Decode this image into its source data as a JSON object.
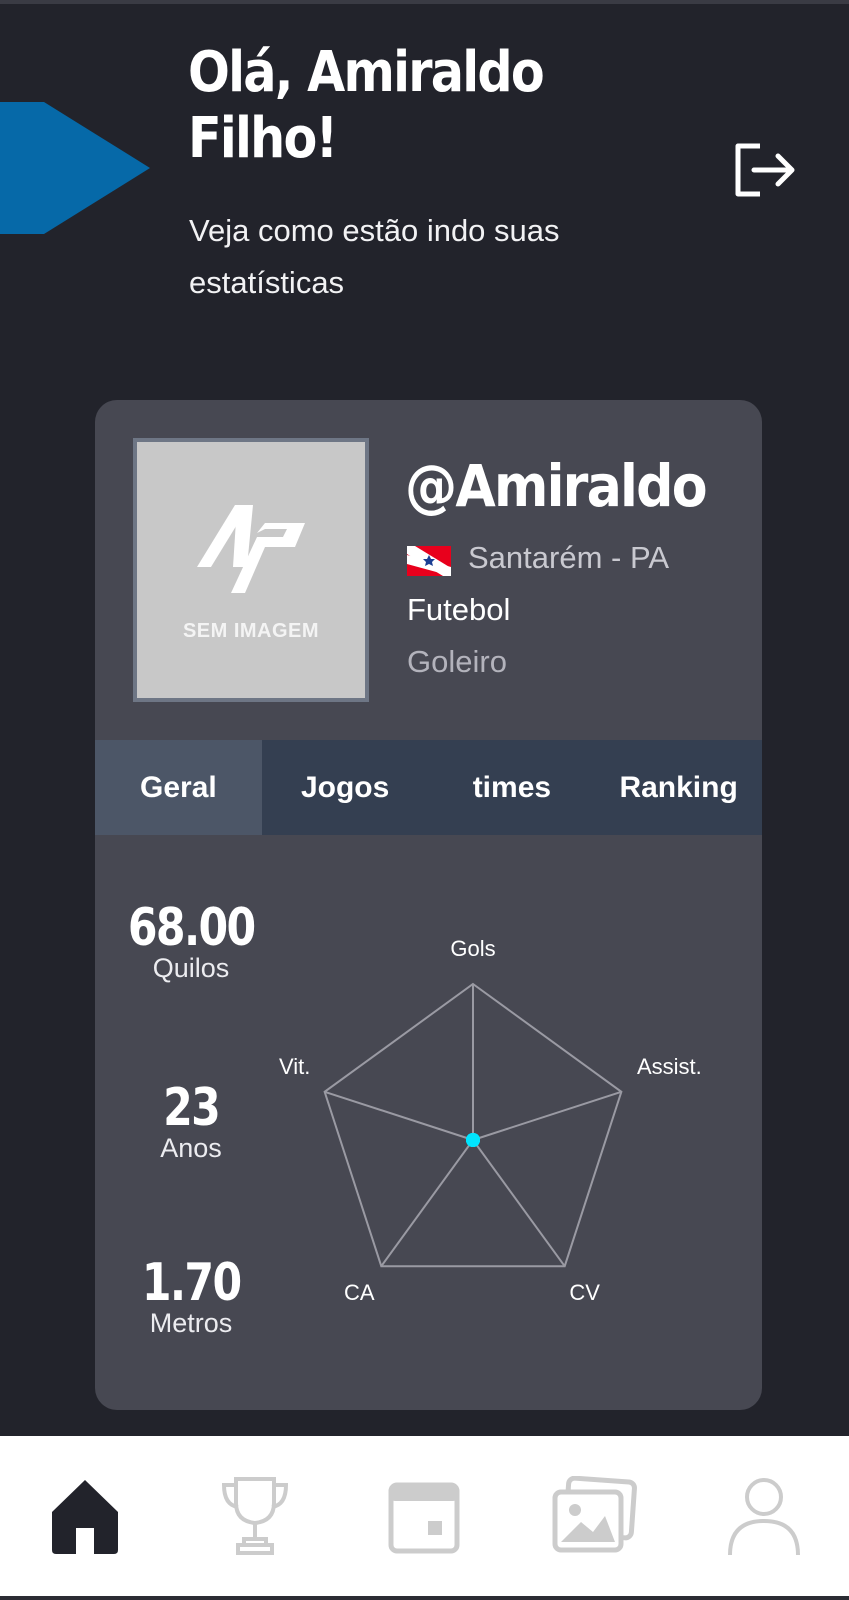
{
  "header": {
    "greeting_line1": "Olá, Amiraldo",
    "greeting_line2": "Filho!",
    "subtitle": "Veja como estão indo suas estatísticas",
    "accent_color": "#0669a8",
    "logout_icon": "logout-icon"
  },
  "profile": {
    "avatar_placeholder": "SEM IMAGEM",
    "username": "@Amiraldo",
    "flag_icon": "para-state-flag-icon",
    "location": "Santarém - PA",
    "sport": "Futebol",
    "position": "Goleiro"
  },
  "tabs": [
    {
      "label": "Geral",
      "active": true
    },
    {
      "label": "Jogos",
      "active": false
    },
    {
      "label": "times",
      "active": false
    },
    {
      "label": "Ranking",
      "active": false
    }
  ],
  "stats": [
    {
      "value": "68.00",
      "label": "Quilos"
    },
    {
      "value": "23",
      "label": "Anos"
    },
    {
      "value": "1.70",
      "label": "Metros"
    }
  ],
  "radar": {
    "axes": [
      "Gols",
      "Assist.",
      "CV",
      "CA",
      "Vit."
    ],
    "values": [
      0,
      0,
      0,
      0,
      0
    ],
    "point_color": "#00e5ff"
  },
  "bottom_nav": [
    {
      "icon": "home-icon",
      "active": true
    },
    {
      "icon": "trophy-icon",
      "active": false
    },
    {
      "icon": "calendar-icon",
      "active": false
    },
    {
      "icon": "gallery-icon",
      "active": false
    },
    {
      "icon": "profile-icon",
      "active": false
    }
  ]
}
